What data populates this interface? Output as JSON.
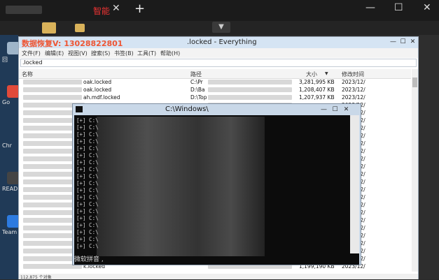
{
  "browser": {
    "tab_label": "智能",
    "tab_close": "✕",
    "new_tab": "+",
    "minimize": "—",
    "maximize": "☐",
    "close": "✕"
  },
  "desktop": {
    "icons": [
      {
        "label": "回",
        "icon": "recycle-bin-icon",
        "color": "#9fb5c9"
      },
      {
        "label": "Go",
        "icon": "chrome-icon",
        "color": "#e04a3a"
      },
      {
        "label": "Chr",
        "icon": "chrome-label-icon",
        "color": "#203a57"
      },
      {
        "label": "READ",
        "icon": "reader-icon",
        "color": "#444444"
      },
      {
        "label": "Team",
        "icon": "team-icon",
        "color": "#2d7be0"
      }
    ]
  },
  "everything": {
    "title": ".locked - Everything",
    "watermark": "数据恢复V: 13028822801",
    "menu": [
      "文件(F)",
      "编辑(E)",
      "视图(V)",
      "搜索(S)",
      "书签(B)",
      "工具(T)",
      "帮助(H)"
    ],
    "search_value": ".locked",
    "columns": {
      "name": "名称",
      "path": "路径",
      "size": "大小",
      "modified": "修改时间"
    },
    "rows": [
      {
        "name": "oak.locked",
        "path": "C:\\Pr",
        "size": "3,281,995 KB",
        "date": "2023/12/"
      },
      {
        "name": "oak.locked",
        "path": "D:\\Ba",
        "size": "1,208,407 KB",
        "date": "2023/12/"
      },
      {
        "name": "ah.mdf.locked",
        "path": "D:\\Top",
        "size": "1,207,937 KB",
        "date": "2023/12/"
      },
      {
        "name": "",
        "path": "",
        "size": "",
        "date": "2023/12/"
      },
      {
        "name": "",
        "path": "",
        "size": "",
        "date": "2023/12/"
      },
      {
        "name": "",
        "path": "",
        "size": "",
        "date": "2023/12/"
      },
      {
        "name": "",
        "path": "",
        "size": "",
        "date": "2023/12/"
      },
      {
        "name": "",
        "path": "",
        "size": "",
        "date": "2023/12/"
      },
      {
        "name": "",
        "path": "",
        "size": "",
        "date": "2023/12/"
      },
      {
        "name": "",
        "path": "",
        "size": "",
        "date": "2023/12/"
      },
      {
        "name": "",
        "path": "",
        "size": "",
        "date": "2023/12/"
      },
      {
        "name": "",
        "path": "",
        "size": "",
        "date": "2023/12/"
      },
      {
        "name": "",
        "path": "",
        "size": "",
        "date": "2023/12/"
      },
      {
        "name": "",
        "path": "",
        "size": "",
        "date": "2023/12/"
      },
      {
        "name": "",
        "path": "",
        "size": "",
        "date": "2023/12/"
      },
      {
        "name": "",
        "path": "",
        "size": "",
        "date": "2023/12/"
      },
      {
        "name": "",
        "path": "",
        "size": "",
        "date": "2023/12/"
      },
      {
        "name": "",
        "path": "",
        "size": "",
        "date": "2023/12/"
      },
      {
        "name": "",
        "path": "",
        "size": "",
        "date": "2023/12/"
      },
      {
        "name": "",
        "path": "",
        "size": "",
        "date": "2023/12/"
      },
      {
        "name": "",
        "path": "",
        "size": "",
        "date": "2023/12/"
      },
      {
        "name": "",
        "path": "",
        "size": "",
        "date": "2023/12/"
      },
      {
        "name": "",
        "path": "",
        "size": "",
        "date": "2023/12/"
      },
      {
        "name": "",
        "path": "",
        "size": "",
        "date": "2023/12/"
      },
      {
        "name": "k.locked",
        "path": "",
        "size": "1,199,190 KB",
        "date": "2023/12/"
      }
    ],
    "status": "112,875 个对象"
  },
  "cmd": {
    "title": "C:\\Windows\\",
    "line_text": "[+] C:\\",
    "line_count": 19
  },
  "ime": "微软拼音 ,"
}
